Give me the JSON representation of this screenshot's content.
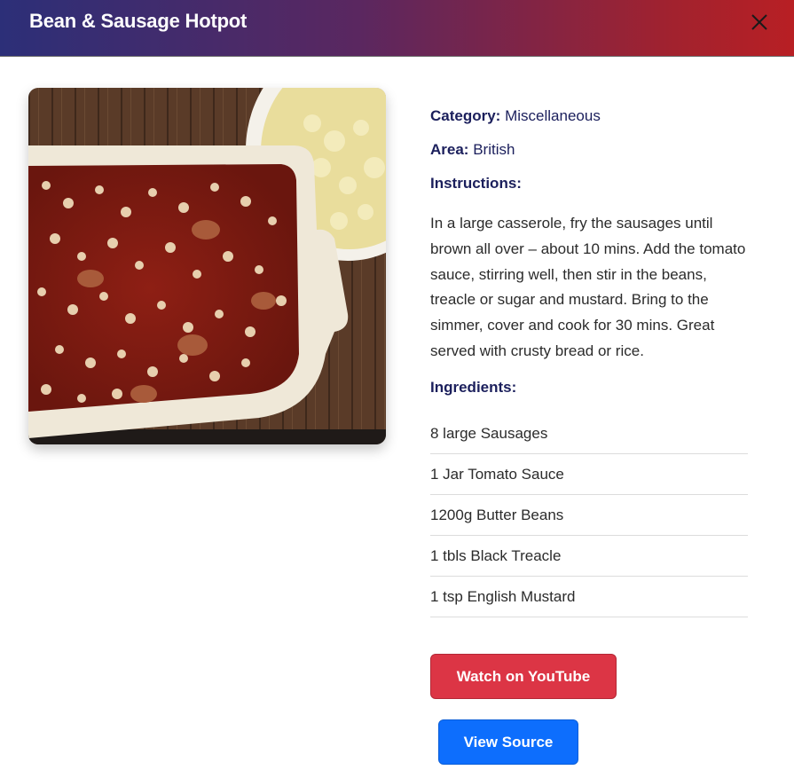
{
  "modal": {
    "title": "Bean & Sausage Hotpot",
    "close_icon": "close-icon"
  },
  "details": {
    "category_label": "Category:",
    "category_value": "Miscellaneous",
    "area_label": "Area:",
    "area_value": "British",
    "instructions_heading": "Instructions:",
    "instructions_text": "In a large casserole, fry the sausages until brown all over – about 10 mins. Add the tomato sauce, stirring well, then stir in the beans, treacle or sugar and mustard. Bring to the simmer, cover and cook for 30 mins. Great served with crusty bread or rice.",
    "ingredients_heading": "Ingredients:",
    "ingredients": [
      "8 large Sausages",
      "1 Jar Tomato Sauce",
      "1200g Butter Beans",
      "1 tbls Black Treacle",
      "1 tsp English Mustard"
    ]
  },
  "actions": {
    "youtube_label": "Watch on YouTube",
    "source_label": "View Source"
  },
  "colors": {
    "header_start": "#2c2f78",
    "header_end": "#b81f24",
    "heading_text": "#1b1f5c",
    "youtube_button": "#dc3545",
    "source_button": "#0d6efd"
  }
}
